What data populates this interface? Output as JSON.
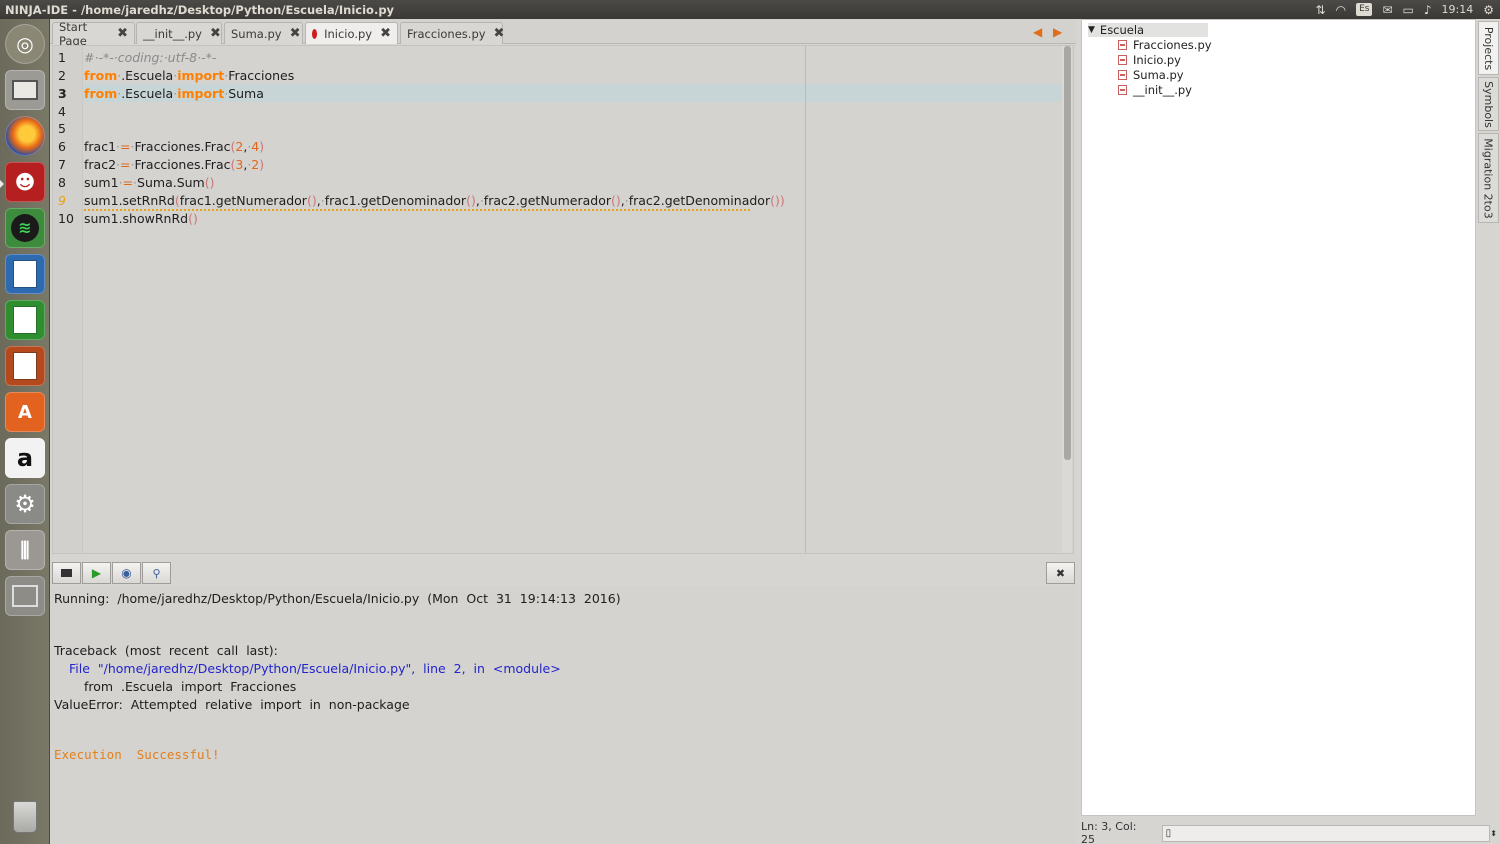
{
  "window": {
    "title": "NINJA-IDE - /home/jaredhz/Desktop/Python/Escuela/Inicio.py",
    "clock": "19:14",
    "keyboard_layout": "Es"
  },
  "launcher": {
    "items": [
      "dash-home",
      "files",
      "firefox",
      "ninja-ide",
      "spotify",
      "writer",
      "calc",
      "impress",
      "software-center",
      "amazon",
      "system-settings",
      "sound-mixer",
      "workspace-switcher",
      "trash"
    ]
  },
  "tabs": [
    {
      "label": "Start Page",
      "active": false,
      "error": false
    },
    {
      "label": "__init__.py",
      "active": false,
      "error": false
    },
    {
      "label": "Suma.py",
      "active": false,
      "error": false
    },
    {
      "label": "Inicio.py",
      "active": true,
      "error": true
    },
    {
      "label": "Fracciones.py",
      "active": false,
      "error": false
    }
  ],
  "editor": {
    "current_line": 3,
    "warning_line": 9,
    "lines": [
      {
        "n": "1",
        "text": "#·-*-·coding:·utf-8·-*-"
      },
      {
        "n": "2",
        "text": "from·.Escuela·import·Fracciones"
      },
      {
        "n": "3",
        "text": "from·.Escuela·import·Suma"
      },
      {
        "n": "4",
        "text": ""
      },
      {
        "n": "5",
        "text": ""
      },
      {
        "n": "6",
        "text": "frac1·=·Fracciones.Frac(2,·4)"
      },
      {
        "n": "7",
        "text": "frac2·=·Fracciones.Frac(3,·2)"
      },
      {
        "n": "8",
        "text": "sum1·=·Suma.Sum()"
      },
      {
        "n": "9",
        "text": "sum1.setRnRd(frac1.getNumerador(),·frac1.getDenominador(),·frac2.getNumerador(),·frac2.getDenominador())"
      },
      {
        "n": "10",
        "text": "sum1.showRnRd()"
      }
    ]
  },
  "output": {
    "running": "Running:  /home/jaredhz/Desktop/Python/Escuela/Inicio.py  (Mon  Oct  31  19:14:13  2016)",
    "traceback": "Traceback  (most  recent  call  last):",
    "file_line": "File  \"/home/jaredhz/Desktop/Python/Escuela/Inicio.py\",  line  2,  in  <module>",
    "source_line": "from  .Escuela  import  Fracciones",
    "error": "ValueError:  Attempted  relative  import  in  non-package",
    "result": "Execution  Successful!"
  },
  "project_tree": {
    "root": "Escuela",
    "files": [
      "Fracciones.py",
      "Inicio.py",
      "Suma.py",
      "__init__.py"
    ]
  },
  "right_dock_tabs": [
    "Projects",
    "Symbols",
    "Migration 2to3"
  ],
  "status": {
    "cursor": "Ln: 3, Col: 25"
  },
  "colors": {
    "keyword": "#ff7f00",
    "error_dot": "#cc1e1e",
    "link": "#2323cc",
    "success": "#e0801c"
  }
}
